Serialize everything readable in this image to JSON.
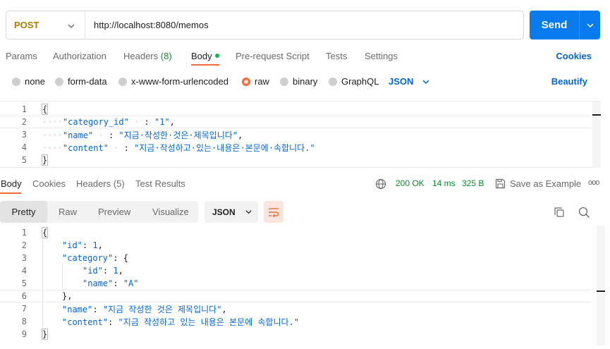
{
  "request": {
    "method": "POST",
    "url": "http://localhost:8080/memos",
    "send_label": "Send"
  },
  "request_tabs": {
    "params": "Params",
    "authorization": "Authorization",
    "headers": "Headers",
    "headers_count": "(8)",
    "body": "Body",
    "pre_request": "Pre-request Script",
    "tests": "Tests",
    "settings": "Settings",
    "cookies": "Cookies"
  },
  "body_types": {
    "none": "none",
    "form_data": "form-data",
    "urlencoded": "x-www-form-urlencoded",
    "raw": "raw",
    "binary": "binary",
    "graphql": "GraphQL",
    "format": "JSON",
    "beautify": "Beautify",
    "selected": "raw"
  },
  "request_body": {
    "line_numbers": [
      "1",
      "2",
      "3",
      "4",
      "5"
    ],
    "open": "{",
    "close": "}",
    "dots2": "····",
    "dots3": "····",
    "dots4": "····",
    "k1": "\"category_id\"",
    "s1": " · ",
    "c1": ": ",
    "v1": "\"1\"",
    "k2": "\"name\"",
    "s2": " · ",
    "c2": ": ",
    "v2": "\"지금·작성한·것은·제목입니다\"",
    "k3": "\"content\"",
    "s3": " · ",
    "c3": ": ",
    "v3": "\"지금·작성하고·있는·내용은·본문에·속합니다.\"",
    "comma": ","
  },
  "response_tabs": {
    "body": "Body",
    "cookies": "Cookies",
    "headers": "Headers",
    "headers_count": "(5)",
    "test_results": "Test Results"
  },
  "response_meta": {
    "status": "200 OK",
    "time": "14 ms",
    "size": "325 B",
    "save_example": "Save as Example",
    "more": "ooo"
  },
  "response_toolbar": {
    "pretty": "Pretty",
    "raw": "Raw",
    "preview": "Preview",
    "visualize": "Visualize",
    "format": "JSON"
  },
  "response_body": {
    "line_numbers": [
      "1",
      "2",
      "3",
      "4",
      "5",
      "6",
      "7",
      "8",
      "9"
    ],
    "open": "{",
    "close": "}",
    "k_id": "\"id\"",
    "v_id": "1",
    "k_category": "\"category\"",
    "cat_open": "{",
    "k_cid": "\"id\"",
    "v_cid": "1",
    "k_cname": "\"name\"",
    "v_cname": "\"A\"",
    "cat_close": "},",
    "k_name": "\"name\"",
    "v_name": "\"지금 작성한 것은 제목입니다\"",
    "k_content": "\"content\"",
    "v_content": "\"지금 작성하고 있는 내용은 본문에 속합니다.\"",
    "colon": ": ",
    "comma": ","
  },
  "colors": {
    "accent": "#f26b3a",
    "send": "#097bed",
    "link": "#0265d2",
    "method": "#ad7a03",
    "ok": "#0c8a2e"
  }
}
